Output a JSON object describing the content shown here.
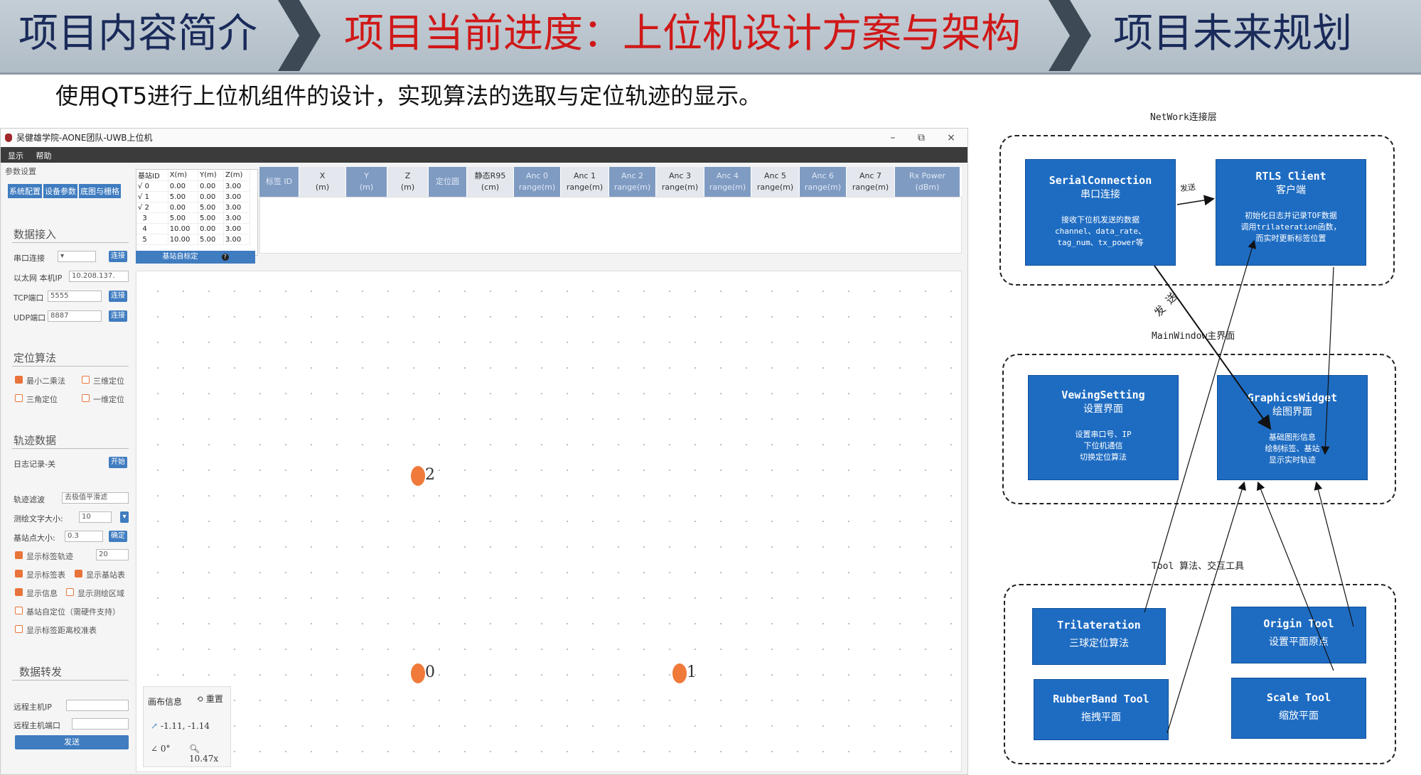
{
  "banner": {
    "section1": "项目内容简介",
    "section2": "项目当前进度：上位机设计方案与架构",
    "section3": "项目未来规划",
    "subtitle": "使用QT5进行上位机组件的设计，实现算法的选取与定位轨迹的显示。"
  },
  "window": {
    "title": "吴健雄学院-AONE团队-UWB上位机",
    "menu": [
      "显示",
      "帮助"
    ],
    "minimize": "–",
    "restore": "⧉",
    "close": "×"
  },
  "left_panel": {
    "header": "参数设置",
    "tabs": [
      "系统配置",
      "设备参数",
      "底图与栅格"
    ],
    "data_access": {
      "title": "数据接入",
      "serial_label": "串口连接",
      "connect_label": "连接",
      "ethernet_label": "以太网 本机IP",
      "ip_value": "10.208.137.",
      "tcp_label": "TCP端口",
      "tcp_value": "5555",
      "udp_label": "UDP端口",
      "udp_value": "8887"
    },
    "algorithm": {
      "title": "定位算法",
      "options": [
        {
          "label": "最小二乘法",
          "checked": true
        },
        {
          "label": "三维定位",
          "checked": false
        },
        {
          "label": "三角定位",
          "checked": false
        },
        {
          "label": "一维定位",
          "checked": false
        }
      ]
    },
    "trajectory": {
      "title": "轨迹数据",
      "log_label": "日志记录-关",
      "log_button": "开始",
      "filter_label": "轨迹滤波",
      "filter_value": "去极值平滑滤",
      "font_label": "测绘文字大小:",
      "font_value": "10",
      "anchor_size_label": "基站点大小:",
      "anchor_size_value": "0.3",
      "confirm_button": "确定",
      "options": [
        {
          "label": "显示标签轨迹",
          "checked": true,
          "value": "20"
        },
        {
          "label": "显示标签表",
          "checked": true
        },
        {
          "label": "显示基站表",
          "checked": true
        },
        {
          "label": "显示信息",
          "checked": true
        },
        {
          "label": "显示测绘区域",
          "checked": false
        },
        {
          "label": "基站自定位（需硬件支持）",
          "checked": false
        },
        {
          "label": "显示标签距离校准表",
          "checked": false
        }
      ]
    },
    "forward": {
      "title": "数据转发",
      "host_ip_label": "远程主机IP",
      "host_port_label": "远程主机端口",
      "send_button": "发送"
    }
  },
  "anchor_table": {
    "headers": [
      "基站ID",
      "X(m)",
      "Y(m)",
      "Z(m)"
    ],
    "rows": [
      {
        "check": "√",
        "id": "0",
        "x": "0.00",
        "y": "0.00",
        "z": "3.00"
      },
      {
        "check": "√",
        "id": "1",
        "x": "5.00",
        "y": "0.00",
        "z": "3.00"
      },
      {
        "check": "√",
        "id": "2",
        "x": "0.00",
        "y": "5.00",
        "z": "3.00"
      },
      {
        "check": "",
        "id": "3",
        "x": "5.00",
        "y": "5.00",
        "z": "3.00"
      },
      {
        "check": "",
        "id": "4",
        "x": "10.00",
        "y": "0.00",
        "z": "3.00"
      },
      {
        "check": "",
        "id": "5",
        "x": "10.00",
        "y": "5.00",
        "z": "3.00"
      }
    ],
    "calibrate_button": "基站自标定"
  },
  "tag_table": {
    "headers": [
      "标签 ID",
      "X\n(m)",
      "Y\n(m)",
      "Z\n(m)",
      "定位圆",
      "静态R95\n(cm)",
      "Anc 0\nrange(m)",
      "Anc 1\nrange(m)",
      "Anc 2\nrange(m)",
      "Anc 3\nrange(m)",
      "Anc 4\nrange(m)",
      "Anc 5\nrange(m)",
      "Anc 6\nrange(m)",
      "Anc 7\nrange(m)",
      "Rx Power\n(dBm)"
    ]
  },
  "canvas": {
    "anchors": [
      {
        "label": "2"
      },
      {
        "label": "0"
      },
      {
        "label": "1"
      }
    ],
    "info": {
      "title": "画布信息",
      "reset": "重置",
      "coords": "-1.11, -1.14",
      "angle": "0°",
      "zoom": "10.47x"
    }
  },
  "diagram": {
    "network_label": "NetWork连接层",
    "main_label": "MainWindow主界面",
    "tool_label": "Tool 算法、交互工具",
    "send1": "发送",
    "send2": "发 送",
    "nodes": {
      "serial": {
        "title": "SerialConnection",
        "sub": "串口连接",
        "d1": "接收下位机发送的数据",
        "d2": "channel、data_rate、",
        "d3": "tag_num、tx_power等"
      },
      "rtls": {
        "title": "RTLS Client",
        "sub": "客户端",
        "d1": "初始化日志并记录TOF数据",
        "d2": "调用trilateration函数，",
        "d3": "而实时更新标签位置"
      },
      "viewing": {
        "title": "VewingSetting",
        "sub": "设置界面",
        "d1": "设置串口号、IP",
        "d2": "下位机通信",
        "d3": "切换定位算法"
      },
      "graphics": {
        "title": "GraphicsWidget",
        "sub": "绘图界面",
        "d1": "基础图形信息",
        "d2": "绘制标签、基站",
        "d3": "显示实时轨迹"
      },
      "trilat": {
        "title": "Trilateration",
        "sub": "三球定位算法"
      },
      "origin": {
        "title": "Origin Tool",
        "sub": "设置平面原点"
      },
      "rubber": {
        "title": "RubberBand Tool",
        "sub": "拖拽平面"
      },
      "scale": {
        "title": "Scale Tool",
        "sub": "缩放平面"
      }
    }
  }
}
